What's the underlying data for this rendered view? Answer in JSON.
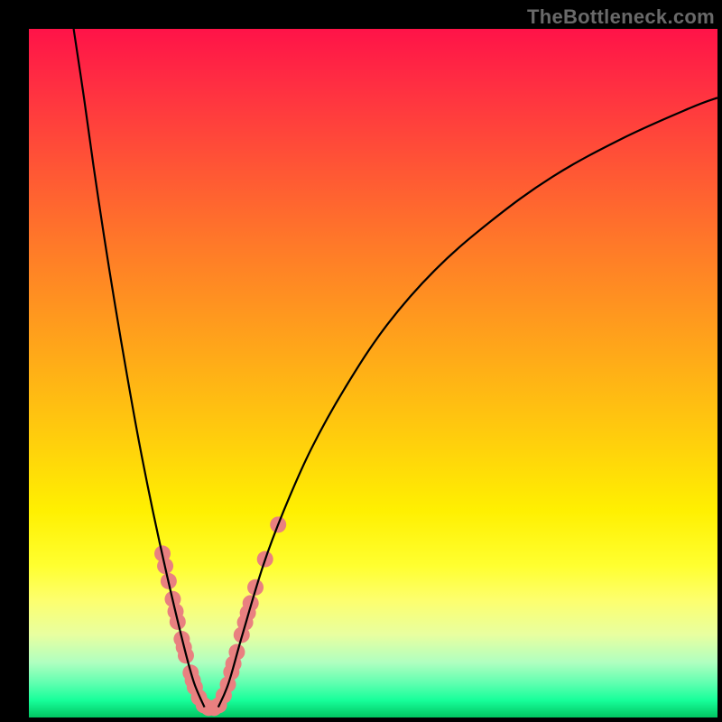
{
  "watermark": "TheBottleneck.com",
  "chart_data": {
    "type": "line",
    "title": "",
    "xlabel": "",
    "ylabel": "",
    "xlim": [
      0,
      100
    ],
    "ylim": [
      0,
      100
    ],
    "grid": false,
    "legend": false,
    "gradient_stops": [
      {
        "pct": 0,
        "color": "#ff1348"
      },
      {
        "pct": 8,
        "color": "#ff2e42"
      },
      {
        "pct": 20,
        "color": "#ff5535"
      },
      {
        "pct": 32,
        "color": "#ff7b28"
      },
      {
        "pct": 45,
        "color": "#ffa21b"
      },
      {
        "pct": 58,
        "color": "#ffc90e"
      },
      {
        "pct": 70,
        "color": "#fff001"
      },
      {
        "pct": 78,
        "color": "#ffff30"
      },
      {
        "pct": 83,
        "color": "#fdff6e"
      },
      {
        "pct": 88,
        "color": "#e8ffa0"
      },
      {
        "pct": 92,
        "color": "#b0ffc0"
      },
      {
        "pct": 95,
        "color": "#60ffb0"
      },
      {
        "pct": 97.5,
        "color": "#17ff9a"
      },
      {
        "pct": 100,
        "color": "#01c562"
      }
    ],
    "series": [
      {
        "name": "left-curve",
        "color": "#000000",
        "points": [
          {
            "x": 6.5,
            "y": 100
          },
          {
            "x": 8.0,
            "y": 90
          },
          {
            "x": 9.4,
            "y": 80
          },
          {
            "x": 10.9,
            "y": 70
          },
          {
            "x": 12.5,
            "y": 60
          },
          {
            "x": 14.2,
            "y": 50
          },
          {
            "x": 16.0,
            "y": 40
          },
          {
            "x": 18.0,
            "y": 30
          },
          {
            "x": 20.2,
            "y": 20
          },
          {
            "x": 22.6,
            "y": 10
          },
          {
            "x": 24.0,
            "y": 5
          },
          {
            "x": 25.5,
            "y": 1.5
          }
        ]
      },
      {
        "name": "right-curve",
        "color": "#000000",
        "points": [
          {
            "x": 27.5,
            "y": 1.5
          },
          {
            "x": 29.0,
            "y": 5
          },
          {
            "x": 31.0,
            "y": 12
          },
          {
            "x": 34.0,
            "y": 22
          },
          {
            "x": 37.0,
            "y": 30
          },
          {
            "x": 41.0,
            "y": 39
          },
          {
            "x": 46.0,
            "y": 48
          },
          {
            "x": 52.0,
            "y": 57
          },
          {
            "x": 59.0,
            "y": 65
          },
          {
            "x": 67.0,
            "y": 72
          },
          {
            "x": 76.0,
            "y": 78.5
          },
          {
            "x": 86.0,
            "y": 84
          },
          {
            "x": 96.0,
            "y": 88.5
          },
          {
            "x": 100.0,
            "y": 90
          }
        ]
      }
    ],
    "scatter": {
      "name": "highlight-dots",
      "color": "#e98080",
      "radius_px": 9,
      "points": [
        {
          "x": 19.4,
          "y": 23.8
        },
        {
          "x": 19.8,
          "y": 22.0
        },
        {
          "x": 20.3,
          "y": 19.8
        },
        {
          "x": 20.9,
          "y": 17.2
        },
        {
          "x": 21.3,
          "y": 15.4
        },
        {
          "x": 21.6,
          "y": 13.9
        },
        {
          "x": 22.2,
          "y": 11.4
        },
        {
          "x": 22.5,
          "y": 10.2
        },
        {
          "x": 22.8,
          "y": 9.0
        },
        {
          "x": 23.5,
          "y": 6.5
        },
        {
          "x": 23.8,
          "y": 5.4
        },
        {
          "x": 24.1,
          "y": 4.4
        },
        {
          "x": 24.7,
          "y": 2.9
        },
        {
          "x": 25.4,
          "y": 1.8
        },
        {
          "x": 26.1,
          "y": 1.4
        },
        {
          "x": 26.9,
          "y": 1.4
        },
        {
          "x": 27.6,
          "y": 1.8
        },
        {
          "x": 28.3,
          "y": 3.2
        },
        {
          "x": 28.9,
          "y": 4.8
        },
        {
          "x": 29.4,
          "y": 6.6
        },
        {
          "x": 29.7,
          "y": 7.8
        },
        {
          "x": 30.2,
          "y": 9.5
        },
        {
          "x": 30.9,
          "y": 12.0
        },
        {
          "x": 31.4,
          "y": 13.8
        },
        {
          "x": 31.8,
          "y": 15.2
        },
        {
          "x": 32.2,
          "y": 16.6
        },
        {
          "x": 32.9,
          "y": 18.9
        },
        {
          "x": 34.3,
          "y": 23.0
        },
        {
          "x": 36.2,
          "y": 28.0
        }
      ]
    }
  }
}
